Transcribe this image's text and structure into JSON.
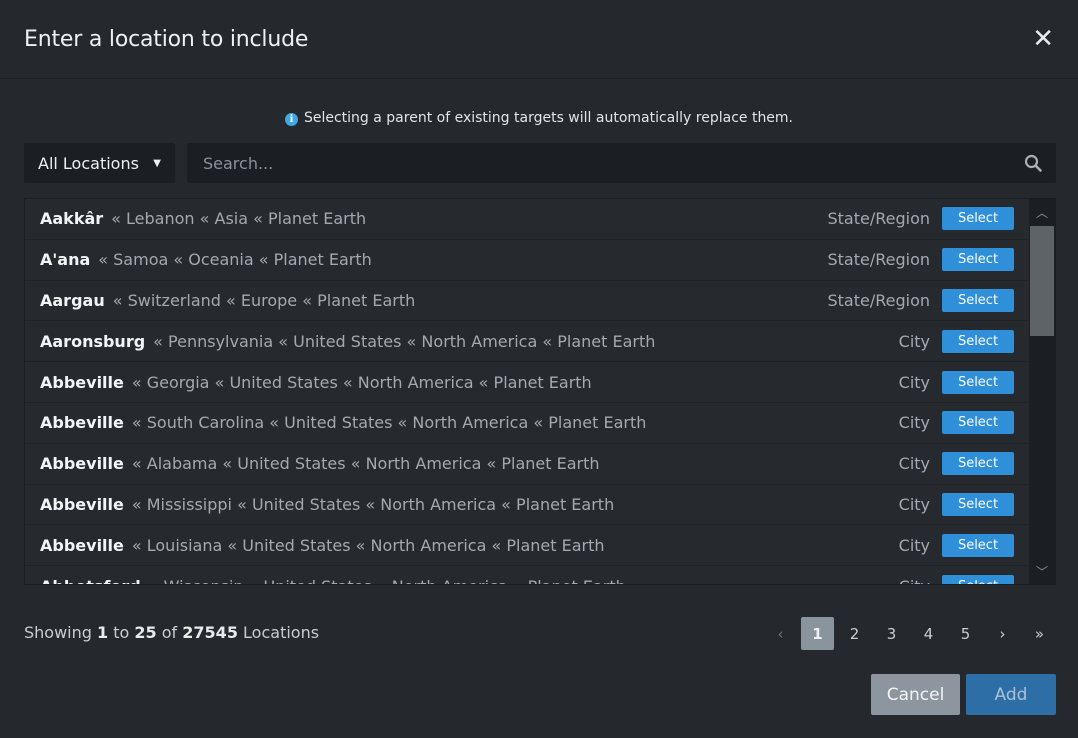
{
  "modal": {
    "title": "Enter a location to include",
    "close_glyph": "✕"
  },
  "info": {
    "icon": "info-icon",
    "icon_glyph": "i",
    "text": "Selecting a parent of existing targets will automatically replace them."
  },
  "filter": {
    "dropdown_label": "All Locations",
    "dropdown_caret": "▼",
    "search_placeholder": "Search...",
    "search_value": ""
  },
  "rows": [
    {
      "name": "Aakkâr",
      "path": "« Lebanon « Asia « Planet Earth",
      "type": "State/Region",
      "action": "Select"
    },
    {
      "name": "A'ana",
      "path": "« Samoa « Oceania « Planet Earth",
      "type": "State/Region",
      "action": "Select"
    },
    {
      "name": "Aargau",
      "path": "« Switzerland « Europe « Planet Earth",
      "type": "State/Region",
      "action": "Select"
    },
    {
      "name": "Aaronsburg",
      "path": "« Pennsylvania « United States « North America « Planet Earth",
      "type": "City",
      "action": "Select"
    },
    {
      "name": "Abbeville",
      "path": "« Georgia « United States « North America « Planet Earth",
      "type": "City",
      "action": "Select"
    },
    {
      "name": "Abbeville",
      "path": "« South Carolina « United States « North America « Planet Earth",
      "type": "City",
      "action": "Select"
    },
    {
      "name": "Abbeville",
      "path": "« Alabama « United States « North America « Planet Earth",
      "type": "City",
      "action": "Select"
    },
    {
      "name": "Abbeville",
      "path": "« Mississippi « United States « North America « Planet Earth",
      "type": "City",
      "action": "Select"
    },
    {
      "name": "Abbeville",
      "path": "« Louisiana « United States « North America « Planet Earth",
      "type": "City",
      "action": "Select"
    },
    {
      "name": "Abbotsford",
      "path": "« Wisconsin « United States « North America « Planet Earth",
      "type": "City",
      "action": "Select"
    }
  ],
  "scrollbar": {
    "up_glyph": "︿",
    "down_glyph": "﹀"
  },
  "summary": {
    "prefix": "Showing",
    "from": "1",
    "to_word": "to",
    "to": "25",
    "of_word": "of",
    "total": "27545",
    "suffix": "Locations"
  },
  "pagination": {
    "prev": "‹",
    "pages": [
      "1",
      "2",
      "3",
      "4",
      "5"
    ],
    "active_page": "1",
    "next": "›",
    "last": "»"
  },
  "actions": {
    "cancel_label": "Cancel",
    "add_label": "Add"
  },
  "colors": {
    "background": "#25292e",
    "select_button": "#2f8fd9",
    "add_button": "#2d6ea6",
    "cancel_button": "#8d969e",
    "info_icon": "#3ea8e6"
  }
}
